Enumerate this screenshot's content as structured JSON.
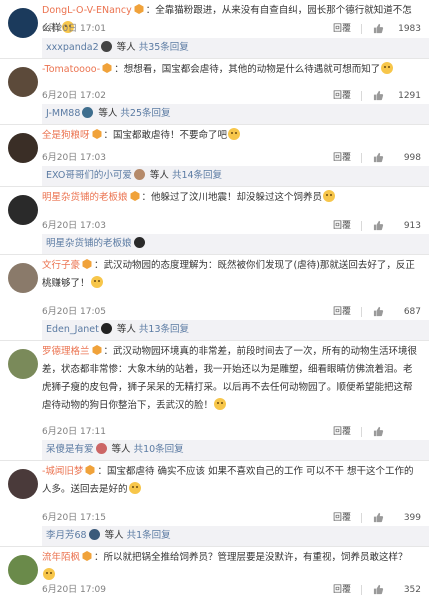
{
  "comments": [
    {
      "author": "DongL-O-V-ENancy",
      "text": "：全靠猫粉跟进，从来没有自查自纠，园长那个德行就知道不怎么样",
      "time": "6月20日 17:01",
      "reply_label": "回覆",
      "likes": "1983",
      "avatar_color": "#1b3a5c",
      "more": {
        "name": "xxxpanda2",
        "suffix": " 等人 ",
        "count": "共35条回复",
        "avatar_color": "#444444"
      }
    },
    {
      "author": "-Tomatoooo-",
      "text": "：想想看，国宝都会虐待，其他的动物是什么待遇就可想而知了",
      "time": "6月20日 17:02",
      "reply_label": "回覆",
      "likes": "1291",
      "avatar_color": "#5c4a3a",
      "more": {
        "name": "J-MM88",
        "suffix": " 等人 ",
        "count": "共25条回复",
        "avatar_color": "#3f6e8e"
      }
    },
    {
      "author": "全是狗粮呀",
      "text": "：国宝都敢虐待！不要命了吧",
      "time": "6月20日 17:03",
      "reply_label": "回覆",
      "likes": "998",
      "avatar_color": "#3a2e26",
      "more": {
        "name": "EXO哥哥们的小可爱",
        "suffix": " 等人 ",
        "count": "共14条回复",
        "avatar_color": "#b58a6a"
      }
    },
    {
      "author": "明星杂货铺的老板娘",
      "text": "：他躲过了汶川地震！却没躲过这个饲养员",
      "time": "6月20日 17:03",
      "reply_label": "回覆",
      "likes": "913",
      "avatar_color": "#2a2a2a",
      "more": {
        "name": "明星杂货铺的老板娘",
        "suffix": "",
        "count": "",
        "avatar_color": "#2a2a2a"
      }
    },
    {
      "author": "文行子豪",
      "text": "：武汉动物园的态度理解为：既然被你们发现了(虐待)那就送回去好了，反正桃赚够了！",
      "time": "6月20日 17:05",
      "reply_label": "回覆",
      "likes": "687",
      "avatar_color": "#8a7a6a",
      "more": {
        "name": "Eden_Janet",
        "suffix": " 等人 ",
        "count": "共13条回复",
        "avatar_color": "#222222"
      }
    },
    {
      "author": "罗德理格兰",
      "text": "：武汉动物园环境真的非常差，前段时间去了一次，所有的动物生活环境很差，状态都非常惨：大象木纳的站着，我一开始还以为是雕塑，细看眼睛仿佛流着泪。老虎狮子瘦的皮包骨，狮子呆呆的无精打采。以后再不去任何动物园了。顺便希望能把这帮虐待动物的狗日你整治下，丢武汉的脸！",
      "time": "6月20日 17:11",
      "reply_label": "回覆",
      "likes": "",
      "avatar_color": "#7a8a5a",
      "more": {
        "name": "呆傻是有爱",
        "suffix": " 等人 ",
        "count": "共10条回复",
        "avatar_color": "#cc6666"
      }
    },
    {
      "author": "-城闻旧梦",
      "text": "：国宝都虐待  确实不应该  如果不喜欢自己的工作  可以不干  想干这个工作的人多。送回去是好的",
      "time": "6月20日 17:15",
      "reply_label": "回覆",
      "likes": "399",
      "avatar_color": "#4a3a3a",
      "more": {
        "name": "李月芳68",
        "suffix": " 等人 ",
        "count": "共1条回复",
        "avatar_color": "#3a5a7a"
      }
    },
    {
      "author": "流年陌枫",
      "text": "：所以就把锅全推给饲养员？管理层要是没默许，有重视，饲养员敢这样？",
      "time": "6月20日 17:09",
      "reply_label": "回覆",
      "likes": "352",
      "avatar_color": "#6a8a4a",
      "more": null
    }
  ]
}
